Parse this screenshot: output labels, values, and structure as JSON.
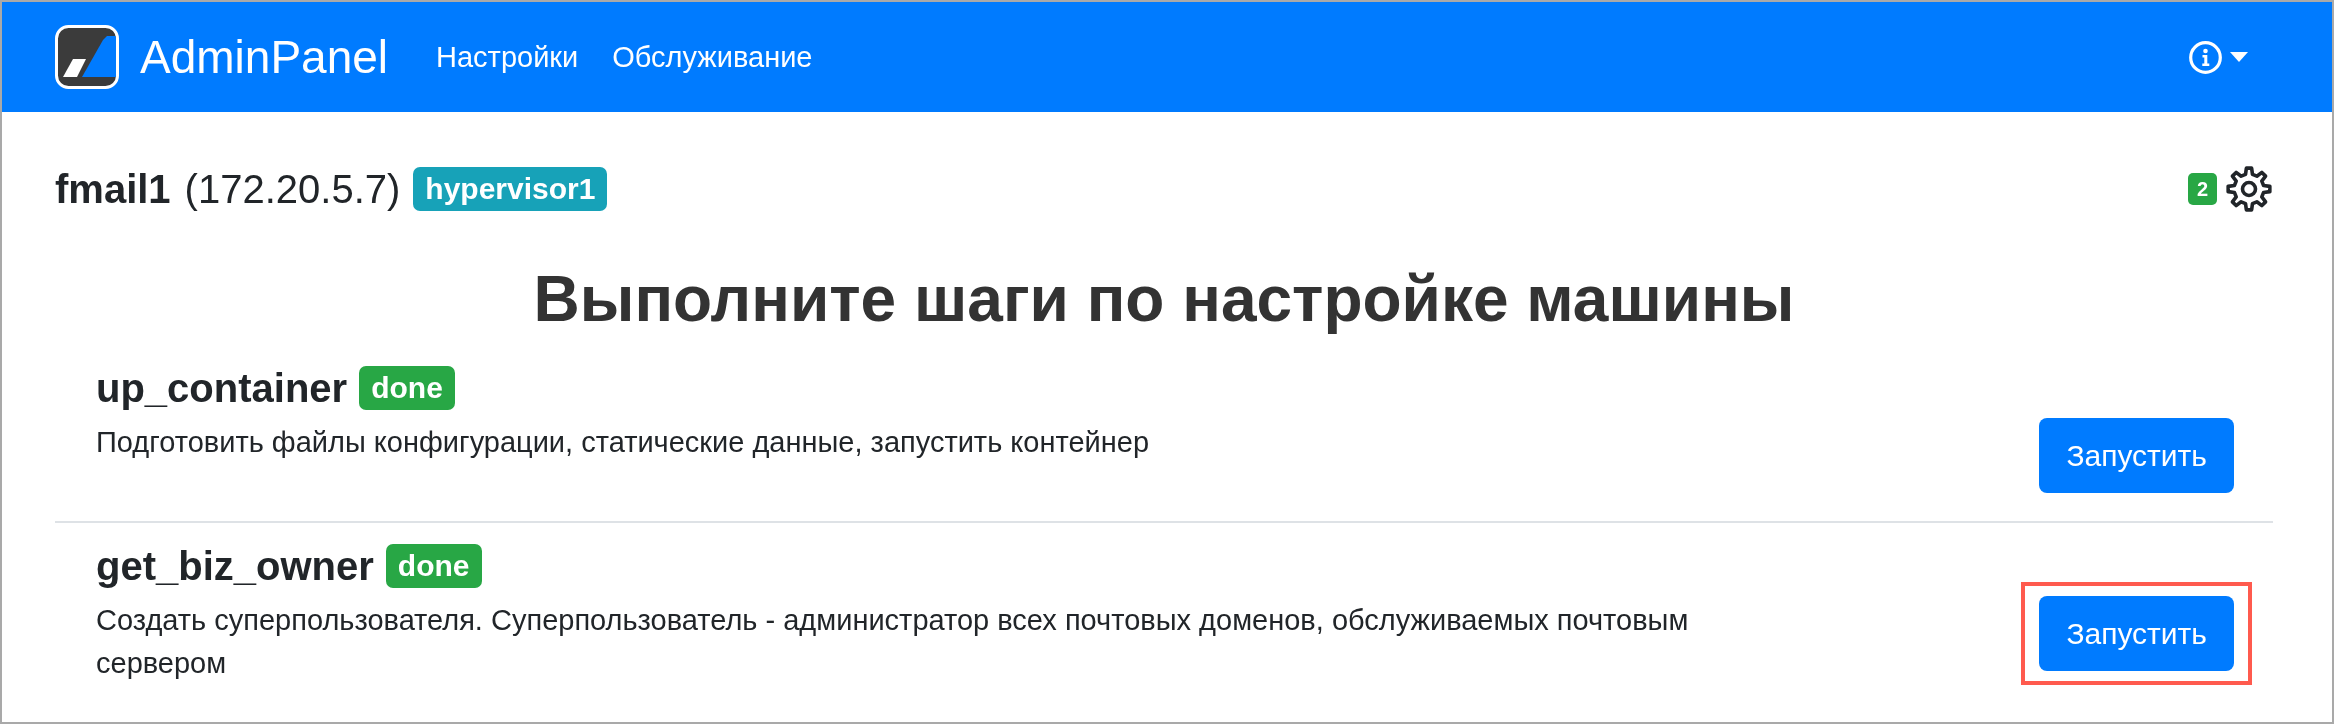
{
  "navbar": {
    "brand": "AdminPanel",
    "links": [
      {
        "label": "Настройки"
      },
      {
        "label": "Обслуживание"
      }
    ]
  },
  "host": {
    "name": "fmail1",
    "address": "(172.20.5.7)",
    "tag": "hypervisor1",
    "badge_count": "2"
  },
  "heading": "Выполните шаги по настройке машины",
  "steps": [
    {
      "name": "up_container",
      "status": "done",
      "description": "Подготовить файлы конфигурации, статические данные, запустить контейнер",
      "button": "Запустить",
      "highlighted": false
    },
    {
      "name": "get_biz_owner",
      "status": "done",
      "description": "Создать суперпользователя. Суперпользователь - администратор всех почтовых доменов, обслуживаемых почтовым сервером",
      "button": "Запустить",
      "highlighted": true
    }
  ]
}
